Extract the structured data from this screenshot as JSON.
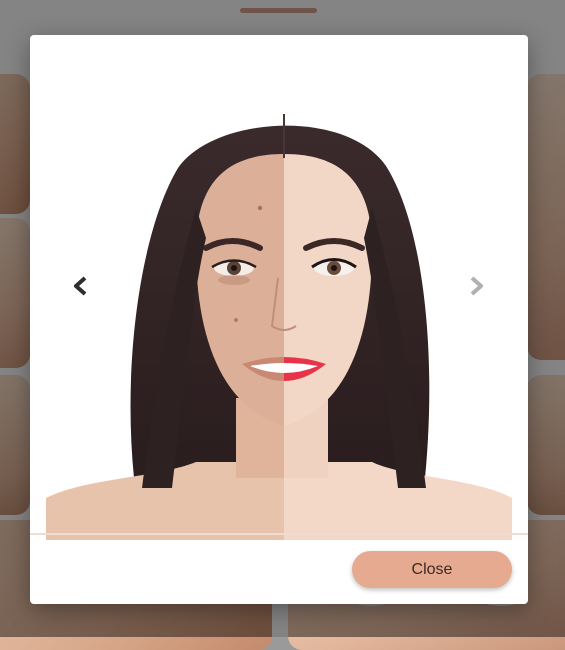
{
  "modal": {
    "close_label": "Close",
    "photo_icon": "before-after-face-photo",
    "prev_icon": "chevron-left-icon",
    "next_icon": "chevron-right-icon"
  },
  "colors": {
    "accent": "#e5aa90",
    "handle": "#c99a86",
    "divider": "#f1dcd3",
    "overlay": "rgba(0,0,0,0.45)"
  }
}
